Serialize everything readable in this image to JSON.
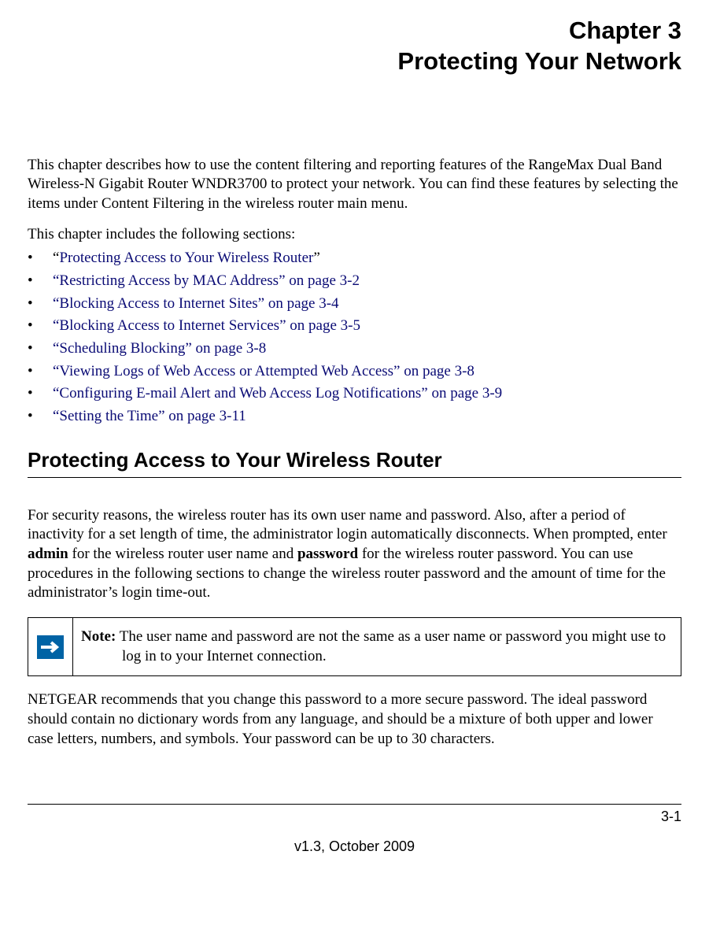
{
  "header": {
    "chapter_line1": "Chapter 3",
    "chapter_line2": "Protecting Your Network"
  },
  "intro": "This chapter describes how to use the content filtering and reporting features of the RangeMax Dual Band Wireless-N Gigabit Router WNDR3700 to protect your network. You can find these features by selecting the items under Content Filtering in the wireless router main menu.",
  "sections_intro": "This chapter includes the following sections:",
  "toc": [
    {
      "pre": "“",
      "link": "Protecting Access to Your Wireless Router",
      "post": "”"
    },
    {
      "pre": "",
      "link": "“Restricting Access by MAC Address” on page 3-2",
      "post": ""
    },
    {
      "pre": "",
      "link": "“Blocking Access to Internet Sites” on page 3-4",
      "post": ""
    },
    {
      "pre": "",
      "link": "“Blocking Access to Internet Services” on page 3-5",
      "post": ""
    },
    {
      "pre": "",
      "link": "“Scheduling Blocking” on page 3-8",
      "post": ""
    },
    {
      "pre": "",
      "link": "“Viewing Logs of Web Access or Attempted Web Access” on page 3-8",
      "post": ""
    },
    {
      "pre": "",
      "link": "“Configuring E-mail Alert and Web Access Log Notifications” on page 3-9",
      "post": ""
    },
    {
      "pre": "",
      "link": "“Setting the Time” on page 3-11",
      "post": ""
    }
  ],
  "section_heading": "Protecting Access to Your Wireless Router",
  "body1_a": "For security reasons, the wireless router has its own user name and password. Also, after a period of inactivity for a set length of time, the administrator login automatically disconnects. When prompted, enter ",
  "body1_bold1": "admin",
  "body1_b": " for the wireless router user name and ",
  "body1_bold2": "password",
  "body1_c": " for the wireless router password. You can use procedures in the following sections to change the wireless router password and the amount of time for the administrator’s login time-out.",
  "note_label": "Note:",
  "note_text": " The user name and password are not the same as a user name or password you might use to log in to your Internet connection.",
  "body2": "NETGEAR recommends that you change this password to a more secure password. The ideal password should contain no dictionary words from any language, and should be a mixture of both upper and lower case letters, numbers, and symbols. Your password can be up to 30 characters.",
  "footer": {
    "page_num": "3-1",
    "version": "v1.3, October 2009"
  }
}
